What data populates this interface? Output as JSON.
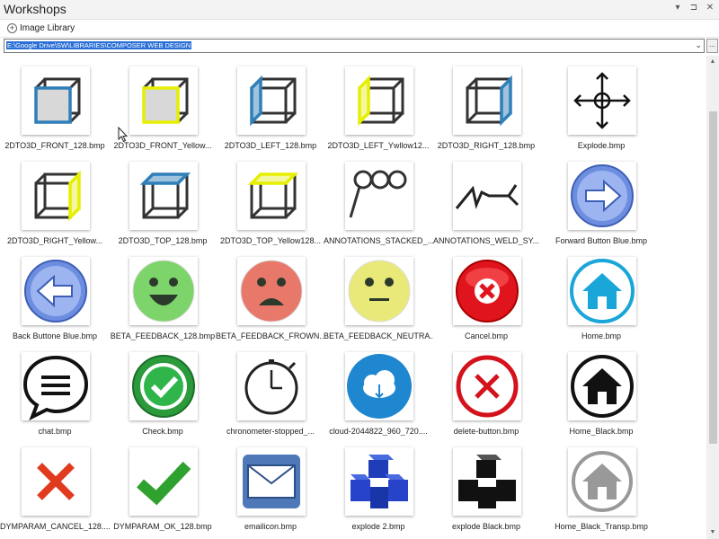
{
  "window": {
    "title": "Workshops",
    "btn_pin": "▾",
    "btn_float": "⊐",
    "btn_close": "✕"
  },
  "panel": {
    "label": "Image Library",
    "expander": "+"
  },
  "path": {
    "value": "E:\\Google Drive\\SW\\LIBRARIES\\COMPOSER WEB DESIGN",
    "dropdown": "⌄",
    "browse": "..."
  },
  "scroll": {
    "up": "▲",
    "down": "▼"
  },
  "images": [
    {
      "name": "2DTO3D_FRONT_128.bmp",
      "icon": "cube-front-icon"
    },
    {
      "name": "2DTO3D_FRONT_Yellow...",
      "icon": "cube-front-yellow-icon"
    },
    {
      "name": "2DTO3D_LEFT_128.bmp",
      "icon": "cube-left-icon"
    },
    {
      "name": "2DTO3D_LEFT_Ywllow12...",
      "icon": "cube-left-yellow-icon"
    },
    {
      "name": "2DTO3D_RIGHT_128.bmp",
      "icon": "cube-right-icon"
    },
    {
      "name": "Explode.bmp",
      "icon": "explode-arrows-icon"
    },
    {
      "name": "2DTO3D_RIGHT_Yellow...",
      "icon": "cube-right-yellow-icon"
    },
    {
      "name": "2DTO3D_TOP_128.bmp",
      "icon": "cube-top-icon"
    },
    {
      "name": "2DTO3D_TOP_Yellow128...",
      "icon": "cube-top-yellow-icon"
    },
    {
      "name": "ANNOTATIONS_STACKED_...",
      "icon": "stacked-balloon-icon"
    },
    {
      "name": "ANNOTATIONS_WELD_SY...",
      "icon": "weld-symbol-icon"
    },
    {
      "name": "Forward Button Blue.bmp",
      "icon": "forward-arrow-icon"
    },
    {
      "name": "Back Buttone Blue.bmp",
      "icon": "back-arrow-icon"
    },
    {
      "name": "BETA_FEEDBACK_128.bmp",
      "icon": "happy-face-icon"
    },
    {
      "name": "BETA_FEEDBACK_FROWN...",
      "icon": "frown-face-icon"
    },
    {
      "name": "BETA_FEEDBACK_NEUTRA...",
      "icon": "neutral-face-icon"
    },
    {
      "name": "Cancel.bmp",
      "icon": "cancel-x-icon"
    },
    {
      "name": "Home.bmp",
      "icon": "home-blue-icon"
    },
    {
      "name": "chat.bmp",
      "icon": "chat-bubble-icon"
    },
    {
      "name": "Check.bmp",
      "icon": "check-circle-icon"
    },
    {
      "name": "chronometer-stopped_...",
      "icon": "stopwatch-icon"
    },
    {
      "name": "cloud-2044822_960_720....",
      "icon": "cloud-download-icon"
    },
    {
      "name": "delete-button.bmp",
      "icon": "delete-x-circle-icon"
    },
    {
      "name": "Home_Black.bmp",
      "icon": "home-black-icon"
    },
    {
      "name": "DYMPARAM_CANCEL_128....",
      "icon": "red-x-icon"
    },
    {
      "name": "DYMPARAM_OK_128.bmp",
      "icon": "green-check-icon"
    },
    {
      "name": "emailicon.bmp",
      "icon": "envelope-icon"
    },
    {
      "name": "explode 2.bmp",
      "icon": "explode-blue-cubes-icon"
    },
    {
      "name": "explode Black.bmp",
      "icon": "explode-black-cubes-icon"
    },
    {
      "name": "Home_Black_Transp.bmp",
      "icon": "home-gray-icon"
    }
  ],
  "colors": {
    "selection": "#2a6fd6",
    "yellow": "#e6ef00",
    "blue": "#2f7fb8",
    "green": "#2fa24a",
    "red": "#d92b2b"
  }
}
